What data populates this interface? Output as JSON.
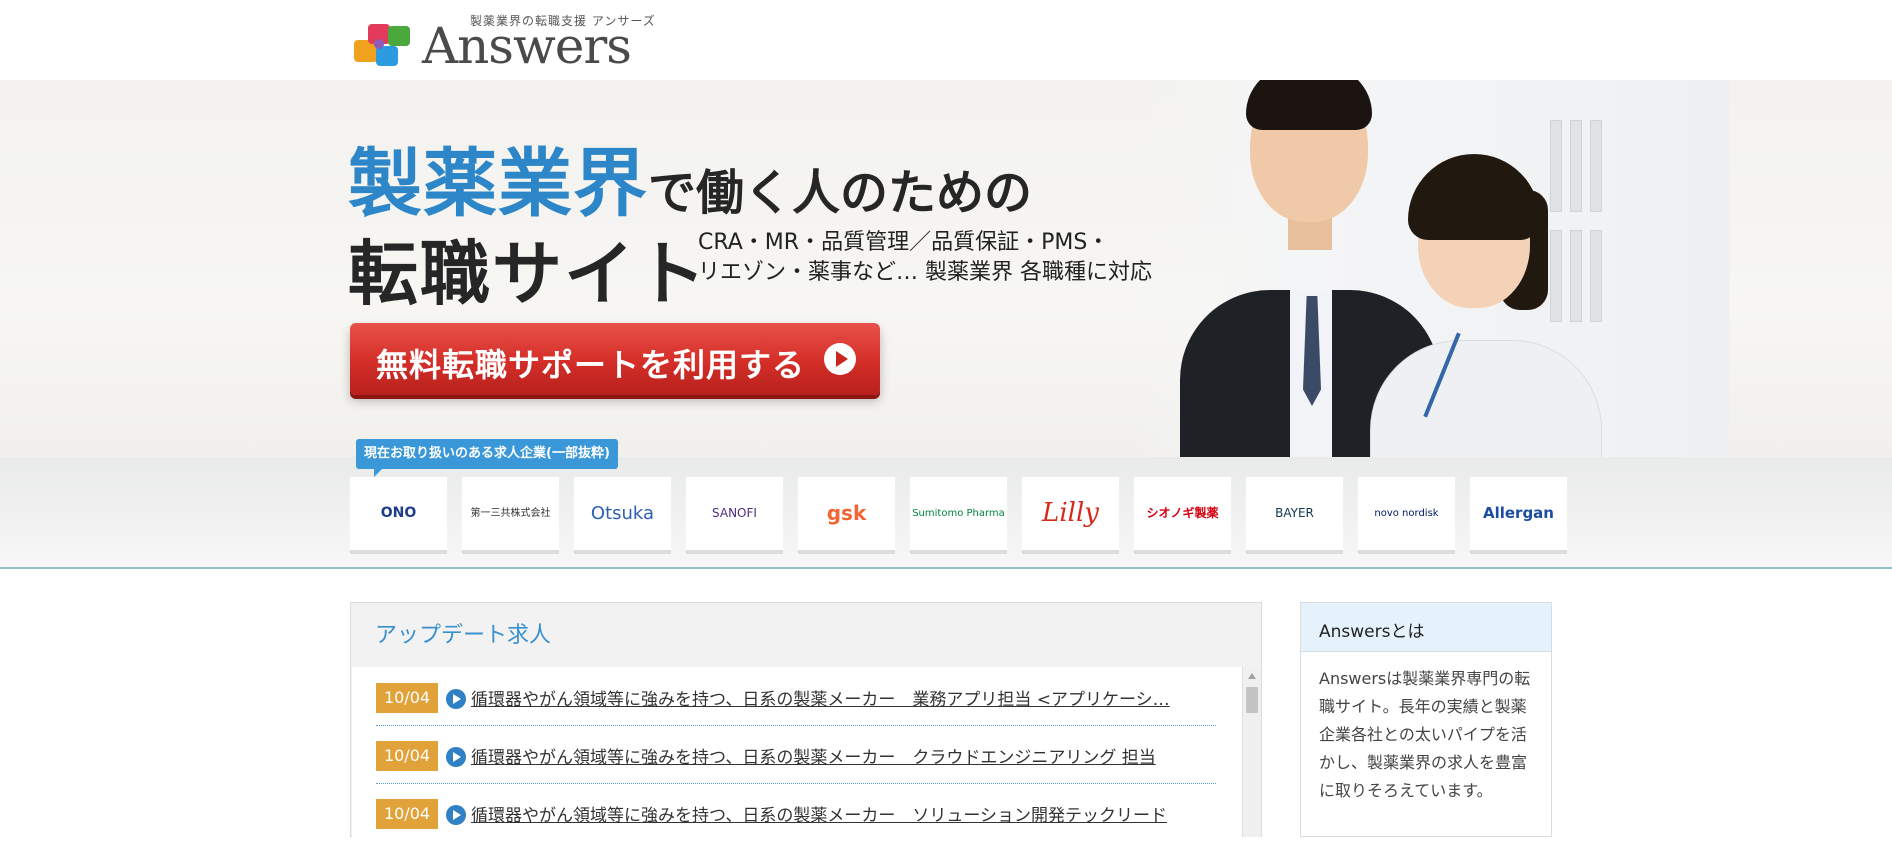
{
  "header": {
    "tagline": "製薬業界の転職支援 アンサーズ",
    "brand": "Answers"
  },
  "hero": {
    "title_highlight": "製薬業界",
    "title_rest": "で働く人のための",
    "title_line2": "転職サイト",
    "subtitle_line1": "CRA・MR・品質管理／品質保証・PMS・",
    "subtitle_line2": "リエゾン・薬事など… 製薬業界 各職種に対応",
    "cta_label": "無料転職サポートを利用する"
  },
  "companies": {
    "tab_label": "現在お取り扱いのある求人企業(一部抜粋)",
    "items": [
      {
        "name": "ONO",
        "color": "#1e3e8c"
      },
      {
        "name": "第一三共株式会社",
        "color": "#333333"
      },
      {
        "name": "Otsuka",
        "color": "#2d5fb4"
      },
      {
        "name": "SANOFI",
        "color": "#4b2e83"
      },
      {
        "name": "gsk",
        "color": "#f36633"
      },
      {
        "name": "Sumitomo Pharma",
        "color": "#00833e"
      },
      {
        "name": "Lilly",
        "color": "#d52b1e"
      },
      {
        "name": "シオノギ製薬",
        "color": "#d7000f"
      },
      {
        "name": "BAYER",
        "color": "#10384f"
      },
      {
        "name": "novo nordisk",
        "color": "#001965"
      },
      {
        "name": "Allergan",
        "color": "#1c4da1"
      }
    ]
  },
  "updates": {
    "title": "アップデート求人",
    "jobs": [
      {
        "date": "10/04",
        "title": "循環器やがん領域等に強みを持つ、日系の製薬メーカー　業務アプリ担当 <アプリケーシ…"
      },
      {
        "date": "10/04",
        "title": "循環器やがん領域等に強みを持つ、日系の製薬メーカー　クラウドエンジニアリング 担当"
      },
      {
        "date": "10/04",
        "title": "循環器やがん領域等に強みを持つ、日系の製薬メーカー　ソリューション開発テックリード"
      }
    ]
  },
  "about": {
    "title": "Answersとは",
    "body": "Answersは製薬業界専門の転職サイト。長年の実績と製薬企業各社との太いパイプを活かし、製薬業界の求人を豊富に取りそろえています。"
  },
  "colors": {
    "accent_blue": "#2d86c7",
    "cta_red": "#d6302a",
    "date_badge": "#e1a23a"
  }
}
